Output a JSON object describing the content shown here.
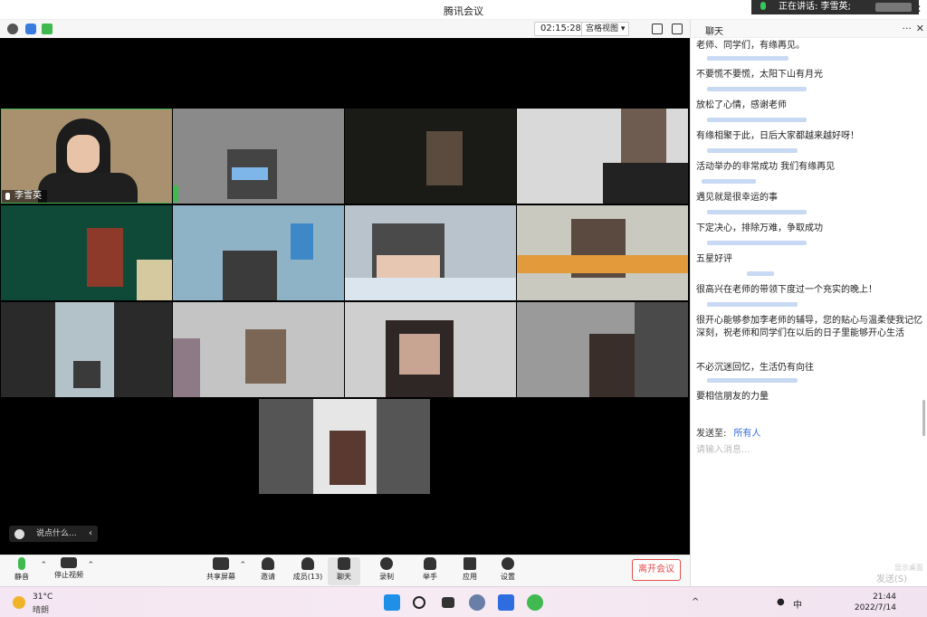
{
  "window": {
    "title": "腾讯会议",
    "close_glyph": "✕"
  },
  "speaking": {
    "label": "正在讲话: 李雪英;"
  },
  "topbar": {
    "timer": "02:15:28",
    "view_label": "宫格视图",
    "view_caret": "▾"
  },
  "video": {
    "speaker_name": "李雪英",
    "say_placeholder": "说点什么...",
    "say_chevron": "‹"
  },
  "toolbar": {
    "mute": "静音",
    "stop_video": "停止视频",
    "share": "共享屏幕",
    "invite": "邀请",
    "members": "成员(13)",
    "chat": "聊天",
    "record": "录制",
    "raise_hand": "举手",
    "apps": "应用",
    "settings": "设置",
    "leave": "离开会议",
    "caret": "⌃"
  },
  "chat": {
    "title": "聊天",
    "more": "···",
    "close": "✕",
    "messages": [
      "老师、同学们，有缘再见。",
      "不要慌不要慌，太阳下山有月光",
      "放松了心情，感谢老师",
      "有缘相聚于此，日后大家都越来越好呀！",
      "活动举办的非常成功  我们有缘再见",
      "遇见就是很幸运的事",
      "下定决心，排除万难，争取成功",
      "五星好评",
      "很高兴在老师的带领下度过一个充实的晚上！",
      "很开心能够参加李老师的辅导，您的贴心与温柔使我记忆深刻，祝老师和同学们在以后的日子里能够开心生活",
      "不必沉迷回忆，生活仍有向往",
      "要相信朋友的力量"
    ],
    "send_to_label": "发送至:",
    "send_to_value": "所有人",
    "input_placeholder": "请输入消息...",
    "send_button": "发送(S)",
    "show_desktop": "显示桌面"
  },
  "taskbar": {
    "temperature": "31°C",
    "weather": "晴朗",
    "ime": "中",
    "time": "21:44",
    "date": "2022/7/14"
  },
  "colors": {
    "accent": "#2d6de0",
    "leave_red": "#e34b4b",
    "speaking_green": "#34c759"
  }
}
